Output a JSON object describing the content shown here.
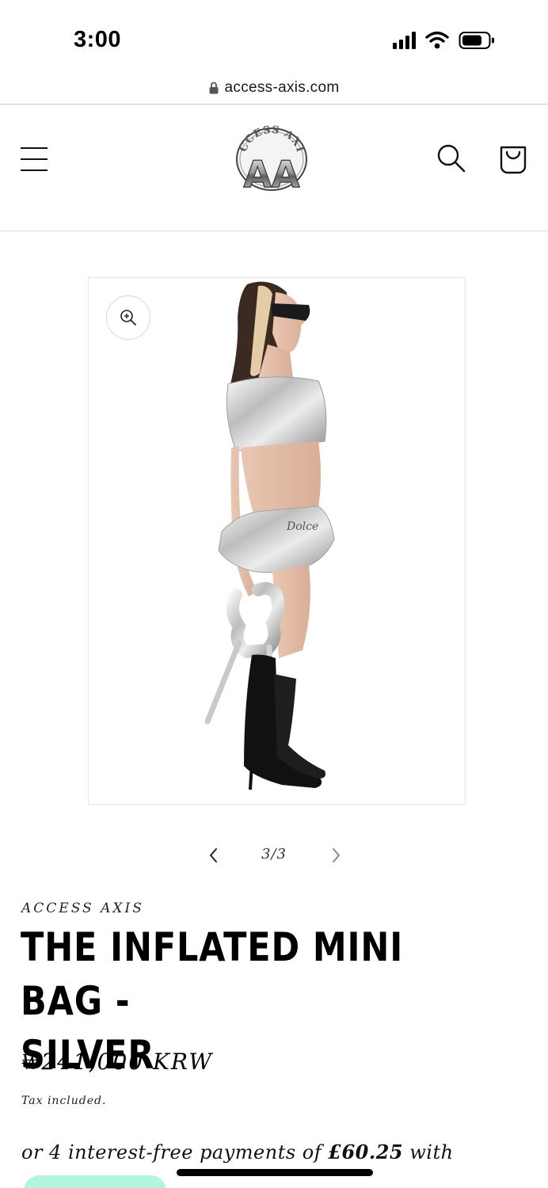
{
  "status_bar": {
    "time": "3:00"
  },
  "browser": {
    "url": "access-axis.com"
  },
  "header": {
    "logo_text_top": "ACCESS AXIS",
    "logo_text_main": "AA"
  },
  "gallery": {
    "counter": "3/3"
  },
  "product": {
    "vendor": "ACCESS AXIS",
    "title_line1": "THE INFLATED MINI BAG -",
    "title_line2": "SILVER",
    "price": "₩241,000 KRW",
    "tax_note": "Tax included.",
    "installments_prefix": "or 4 interest-free payments of ",
    "installments_amount": "£60.25",
    "installments_suffix": " with"
  },
  "colors": {
    "pay_button": "#b3f5dc",
    "text": "#000000"
  }
}
